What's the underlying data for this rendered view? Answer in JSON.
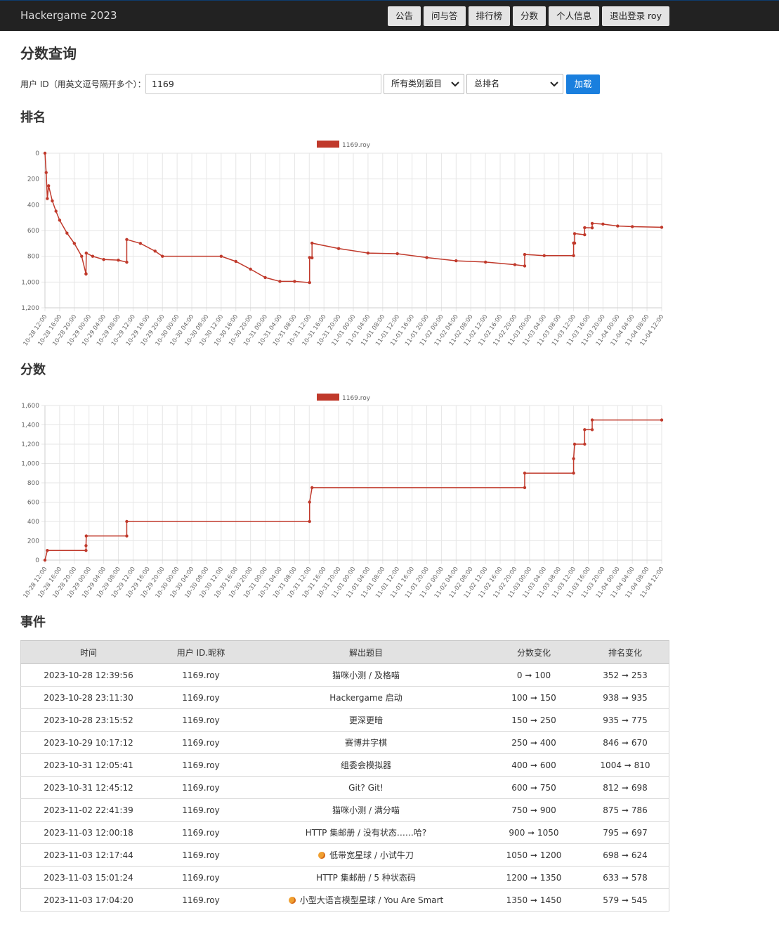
{
  "nav": {
    "brand": "Hackergame 2023",
    "buttons": [
      "公告",
      "问与答",
      "排行榜",
      "分数",
      "个人信息",
      "退出登录 roy"
    ]
  },
  "page_title": "分数查询",
  "filter": {
    "label": "用户 ID（用英文逗号隔开多个）：",
    "user_id_value": "1169",
    "category_select": "所有类别题目",
    "rank_select": "总排名",
    "load_button": "加载"
  },
  "rank_section_title": "排名",
  "score_section_title": "分数",
  "events_section_title": "事件",
  "x_ticks": [
    "10-28 12:00",
    "10-28 16:00",
    "10-28 20:00",
    "10-29 00:00",
    "10-29 04:00",
    "10-29 08:00",
    "10-29 12:00",
    "10-29 16:00",
    "10-29 20:00",
    "10-30 00:00",
    "10-30 04:00",
    "10-30 08:00",
    "10-30 12:00",
    "10-30 16:00",
    "10-30 20:00",
    "10-31 00:00",
    "10-31 04:00",
    "10-31 08:00",
    "10-31 12:00",
    "10-31 16:00",
    "10-31 20:00",
    "11-01 00:00",
    "11-01 04:00",
    "11-01 08:00",
    "11-01 12:00",
    "11-01 16:00",
    "11-01 20:00",
    "11-02 00:00",
    "11-02 04:00",
    "11-02 08:00",
    "11-02 12:00",
    "11-02 16:00",
    "11-02 20:00",
    "11-03 00:00",
    "11-03 04:00",
    "11-03 08:00",
    "11-03 12:00",
    "11-03 16:00",
    "11-03 20:00",
    "11-04 00:00",
    "11-04 04:00",
    "11-04 08:00",
    "11-04 12:00"
  ],
  "chart_data": [
    {
      "type": "line",
      "title": "",
      "xlabel": "",
      "ylabel": "",
      "reversed_y": true,
      "ylim": [
        0,
        1200
      ],
      "y_ticks": [
        "0",
        "200",
        "400",
        "600",
        "800",
        "1,000",
        "1,200"
      ],
      "series": [
        {
          "name": "1169.roy",
          "color": "#c0392b",
          "points": [
            [
              "10-28 12:00",
              0
            ],
            [
              "10-28 12:20",
              150
            ],
            [
              "10-28 12:39",
              352
            ],
            [
              "10-28 13:00",
              253
            ],
            [
              "10-28 14:00",
              370
            ],
            [
              "10-28 15:00",
              450
            ],
            [
              "10-28 16:00",
              520
            ],
            [
              "10-28 18:00",
              620
            ],
            [
              "10-28 20:00",
              700
            ],
            [
              "10-28 22:00",
              800
            ],
            [
              "10-28 23:11",
              938
            ],
            [
              "10-28 23:11",
              935
            ],
            [
              "10-28 23:15",
              775
            ],
            [
              "10-29 01:00",
              800
            ],
            [
              "10-29 04:00",
              825
            ],
            [
              "10-29 08:00",
              830
            ],
            [
              "10-29 10:17",
              846
            ],
            [
              "10-29 10:17",
              670
            ],
            [
              "10-29 14:00",
              700
            ],
            [
              "10-29 18:00",
              760
            ],
            [
              "10-29 20:00",
              800
            ],
            [
              "10-30 12:00",
              800
            ],
            [
              "10-30 16:00",
              840
            ],
            [
              "10-30 20:00",
              900
            ],
            [
              "10-31 00:00",
              965
            ],
            [
              "10-31 04:00",
              995
            ],
            [
              "10-31 08:00",
              995
            ],
            [
              "10-31 12:05",
              1004
            ],
            [
              "10-31 12:05",
              810
            ],
            [
              "10-31 12:45",
              812
            ],
            [
              "10-31 12:45",
              698
            ],
            [
              "10-31 20:00",
              740
            ],
            [
              "11-01 04:00",
              775
            ],
            [
              "11-01 12:00",
              780
            ],
            [
              "11-01 20:00",
              810
            ],
            [
              "11-02 04:00",
              835
            ],
            [
              "11-02 12:00",
              845
            ],
            [
              "11-02 20:00",
              865
            ],
            [
              "11-02 22:41",
              875
            ],
            [
              "11-02 22:41",
              786
            ],
            [
              "11-03 04:00",
              795
            ],
            [
              "11-03 12:00",
              795
            ],
            [
              "11-03 12:00",
              697
            ],
            [
              "11-03 12:17",
              698
            ],
            [
              "11-03 12:17",
              624
            ],
            [
              "11-03 15:01",
              633
            ],
            [
              "11-03 15:01",
              578
            ],
            [
              "11-03 17:04",
              579
            ],
            [
              "11-03 17:04",
              545
            ],
            [
              "11-03 20:00",
              550
            ],
            [
              "11-04 00:00",
              565
            ],
            [
              "11-04 04:00",
              570
            ],
            [
              "11-04 12:00",
              575
            ]
          ]
        }
      ]
    },
    {
      "type": "line",
      "title": "",
      "xlabel": "",
      "ylabel": "",
      "ylim": [
        0,
        1600
      ],
      "y_ticks": [
        "0",
        "200",
        "400",
        "600",
        "800",
        "1,000",
        "1,200",
        "1,400",
        "1,600"
      ],
      "series": [
        {
          "name": "1169.roy",
          "color": "#c0392b",
          "points": [
            [
              "10-28 12:00",
              0
            ],
            [
              "10-28 12:39",
              100
            ],
            [
              "10-28 23:11",
              100
            ],
            [
              "10-28 23:11",
              150
            ],
            [
              "10-28 23:15",
              250
            ],
            [
              "10-29 10:17",
              250
            ],
            [
              "10-29 10:17",
              400
            ],
            [
              "10-31 12:05",
              400
            ],
            [
              "10-31 12:05",
              600
            ],
            [
              "10-31 12:45",
              750
            ],
            [
              "11-02 22:41",
              750
            ],
            [
              "11-02 22:41",
              900
            ],
            [
              "11-03 12:00",
              900
            ],
            [
              "11-03 12:00",
              1050
            ],
            [
              "11-03 12:17",
              1200
            ],
            [
              "11-03 15:01",
              1200
            ],
            [
              "11-03 15:01",
              1350
            ],
            [
              "11-03 17:04",
              1350
            ],
            [
              "11-03 17:04",
              1450
            ],
            [
              "11-04 12:00",
              1450
            ]
          ]
        }
      ]
    }
  ],
  "events": {
    "headers": [
      "时间",
      "用户 ID.昵称",
      "解出题目",
      "分数变化",
      "排名变化"
    ],
    "rows": [
      {
        "time": "2023-10-28 12:39:56",
        "user": "1169.roy",
        "challenge": "猫咪小测 / 及格喵",
        "score": "0 ➞ 100",
        "rank": "352 ➞ 253",
        "icon": ""
      },
      {
        "time": "2023-10-28 23:11:30",
        "user": "1169.roy",
        "challenge": "Hackergame 启动",
        "score": "100 ➞ 150",
        "rank": "938 ➞ 935",
        "icon": ""
      },
      {
        "time": "2023-10-28 23:15:52",
        "user": "1169.roy",
        "challenge": "更深更暗",
        "score": "150 ➞ 250",
        "rank": "935 ➞ 775",
        "icon": ""
      },
      {
        "time": "2023-10-29 10:17:12",
        "user": "1169.roy",
        "challenge": "赛博井字棋",
        "score": "250 ➞ 400",
        "rank": "846 ➞ 670",
        "icon": ""
      },
      {
        "time": "2023-10-31 12:05:41",
        "user": "1169.roy",
        "challenge": "组委会模拟器",
        "score": "400 ➞ 600",
        "rank": "1004 ➞ 810",
        "icon": ""
      },
      {
        "time": "2023-10-31 12:45:12",
        "user": "1169.roy",
        "challenge": "Git? Git!",
        "score": "600 ➞ 750",
        "rank": "812 ➞ 698",
        "icon": ""
      },
      {
        "time": "2023-11-02 22:41:39",
        "user": "1169.roy",
        "challenge": "猫咪小测 / 满分喵",
        "score": "750 ➞ 900",
        "rank": "875 ➞ 786",
        "icon": ""
      },
      {
        "time": "2023-11-03 12:00:18",
        "user": "1169.roy",
        "challenge": "HTTP 集邮册 / 没有状态……哈?",
        "score": "900 ➞ 1050",
        "rank": "795 ➞ 697",
        "icon": ""
      },
      {
        "time": "2023-11-03 12:17:44",
        "user": "1169.roy",
        "challenge": "低带宽星球 / 小试牛刀",
        "score": "1050 ➞ 1200",
        "rank": "698 ➞ 624",
        "icon": "planet-icon"
      },
      {
        "time": "2023-11-03 15:01:24",
        "user": "1169.roy",
        "challenge": "HTTP 集邮册 / 5 种状态码",
        "score": "1200 ➞ 1350",
        "rank": "633 ➞ 578",
        "icon": ""
      },
      {
        "time": "2023-11-03 17:04:20",
        "user": "1169.roy",
        "challenge": "小型大语言模型星球 / You Are Smart",
        "score": "1350 ➞ 1450",
        "rank": "579 ➞ 545",
        "icon": "planet-icon"
      }
    ]
  }
}
